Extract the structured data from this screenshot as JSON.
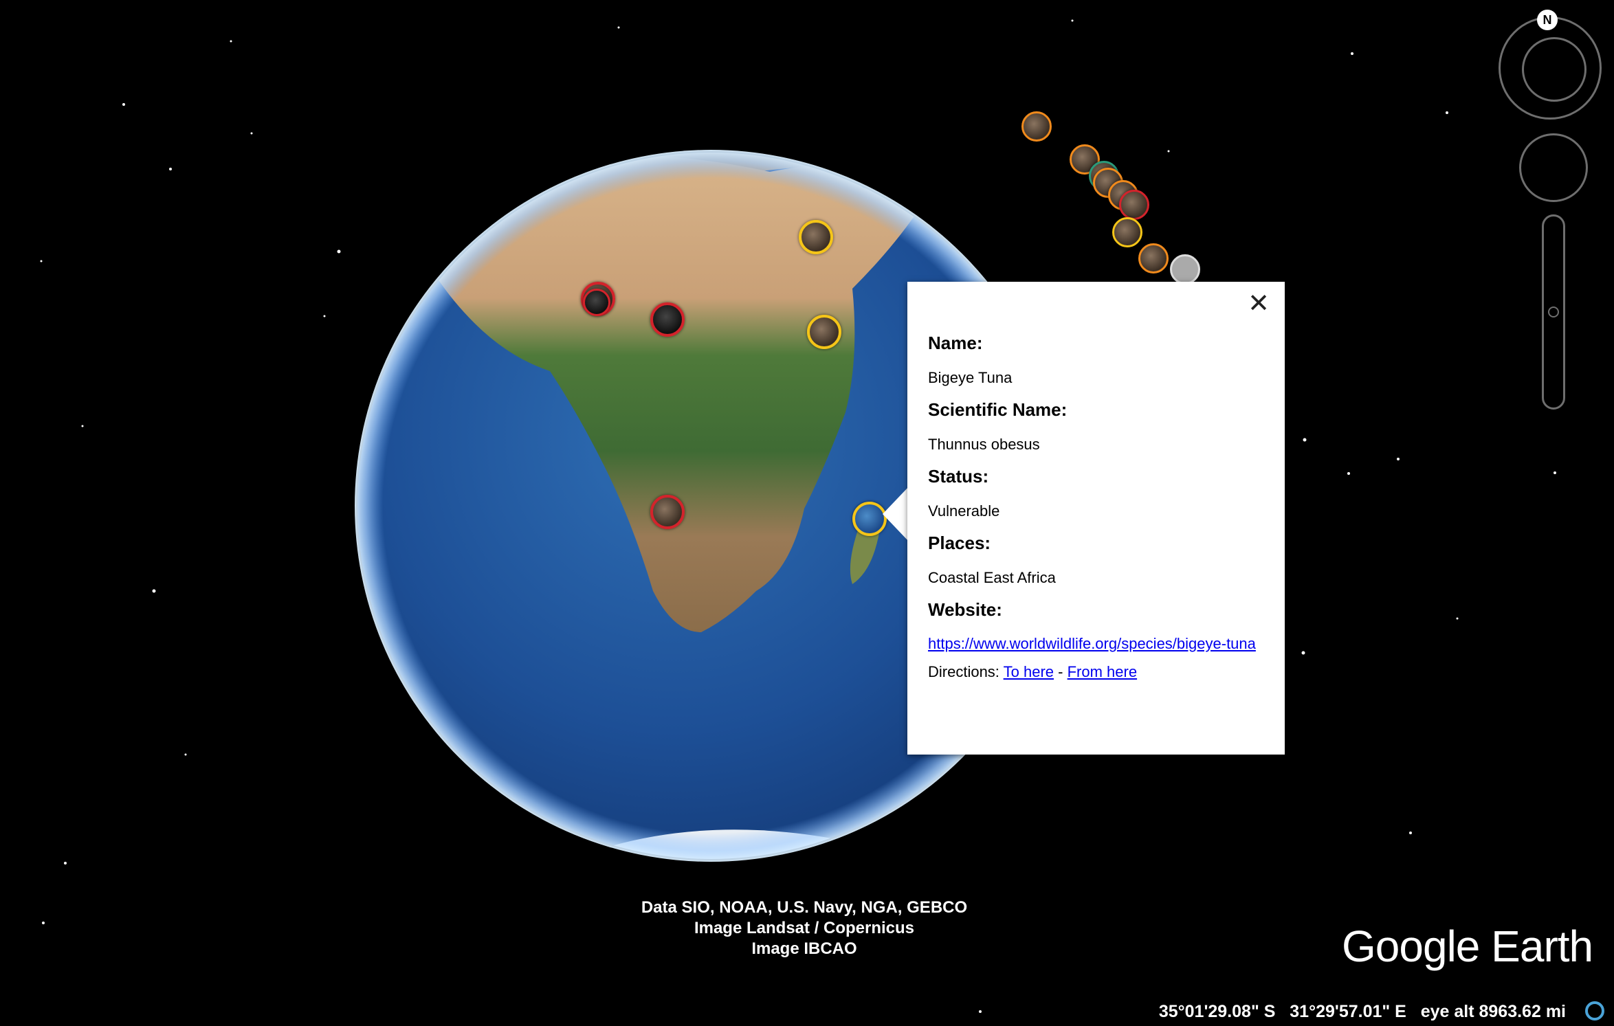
{
  "popup": {
    "labels": {
      "name": "Name:",
      "scientific": "Scientific Name:",
      "status": "Status:",
      "places": "Places:",
      "website": "Website:",
      "directions": "Directions:"
    },
    "name": "Bigeye Tuna",
    "scientific_name": "Thunnus obesus",
    "status": "Vulnerable",
    "places": "Coastal East Africa",
    "website": "https://www.worldwildlife.org/species/bigeye-tuna",
    "directions_to": "To here",
    "directions_sep": "-",
    "directions_from": "From here",
    "close_symbol": "✕"
  },
  "compass": {
    "north_label": "N"
  },
  "attribution": [
    "Data SIO, NOAA, U.S. Navy, NGA, GEBCO",
    "Image Landsat / Copernicus",
    "Image IBCAO"
  ],
  "brand": "Google Earth",
  "status_bar": {
    "latitude": "35°01'29.08\" S",
    "longitude": "31°29'57.01\" E",
    "eye_alt_label": "eye alt",
    "eye_alt": "8963.62 mi"
  },
  "colors": {
    "endangered_ring": "#d3232b",
    "vulnerable_ring": "#f5c518",
    "link": "#0000ee"
  },
  "placemark_icons": [
    "gorilla-icon",
    "gorilla-icon",
    "bird-icon",
    "elephant-icon",
    "rhino-icon",
    "tuna-icon",
    "animal-icon",
    "animal-icon",
    "animal-icon",
    "animal-icon",
    "animal-icon",
    "animal-icon",
    "animal-icon",
    "animal-icon"
  ]
}
